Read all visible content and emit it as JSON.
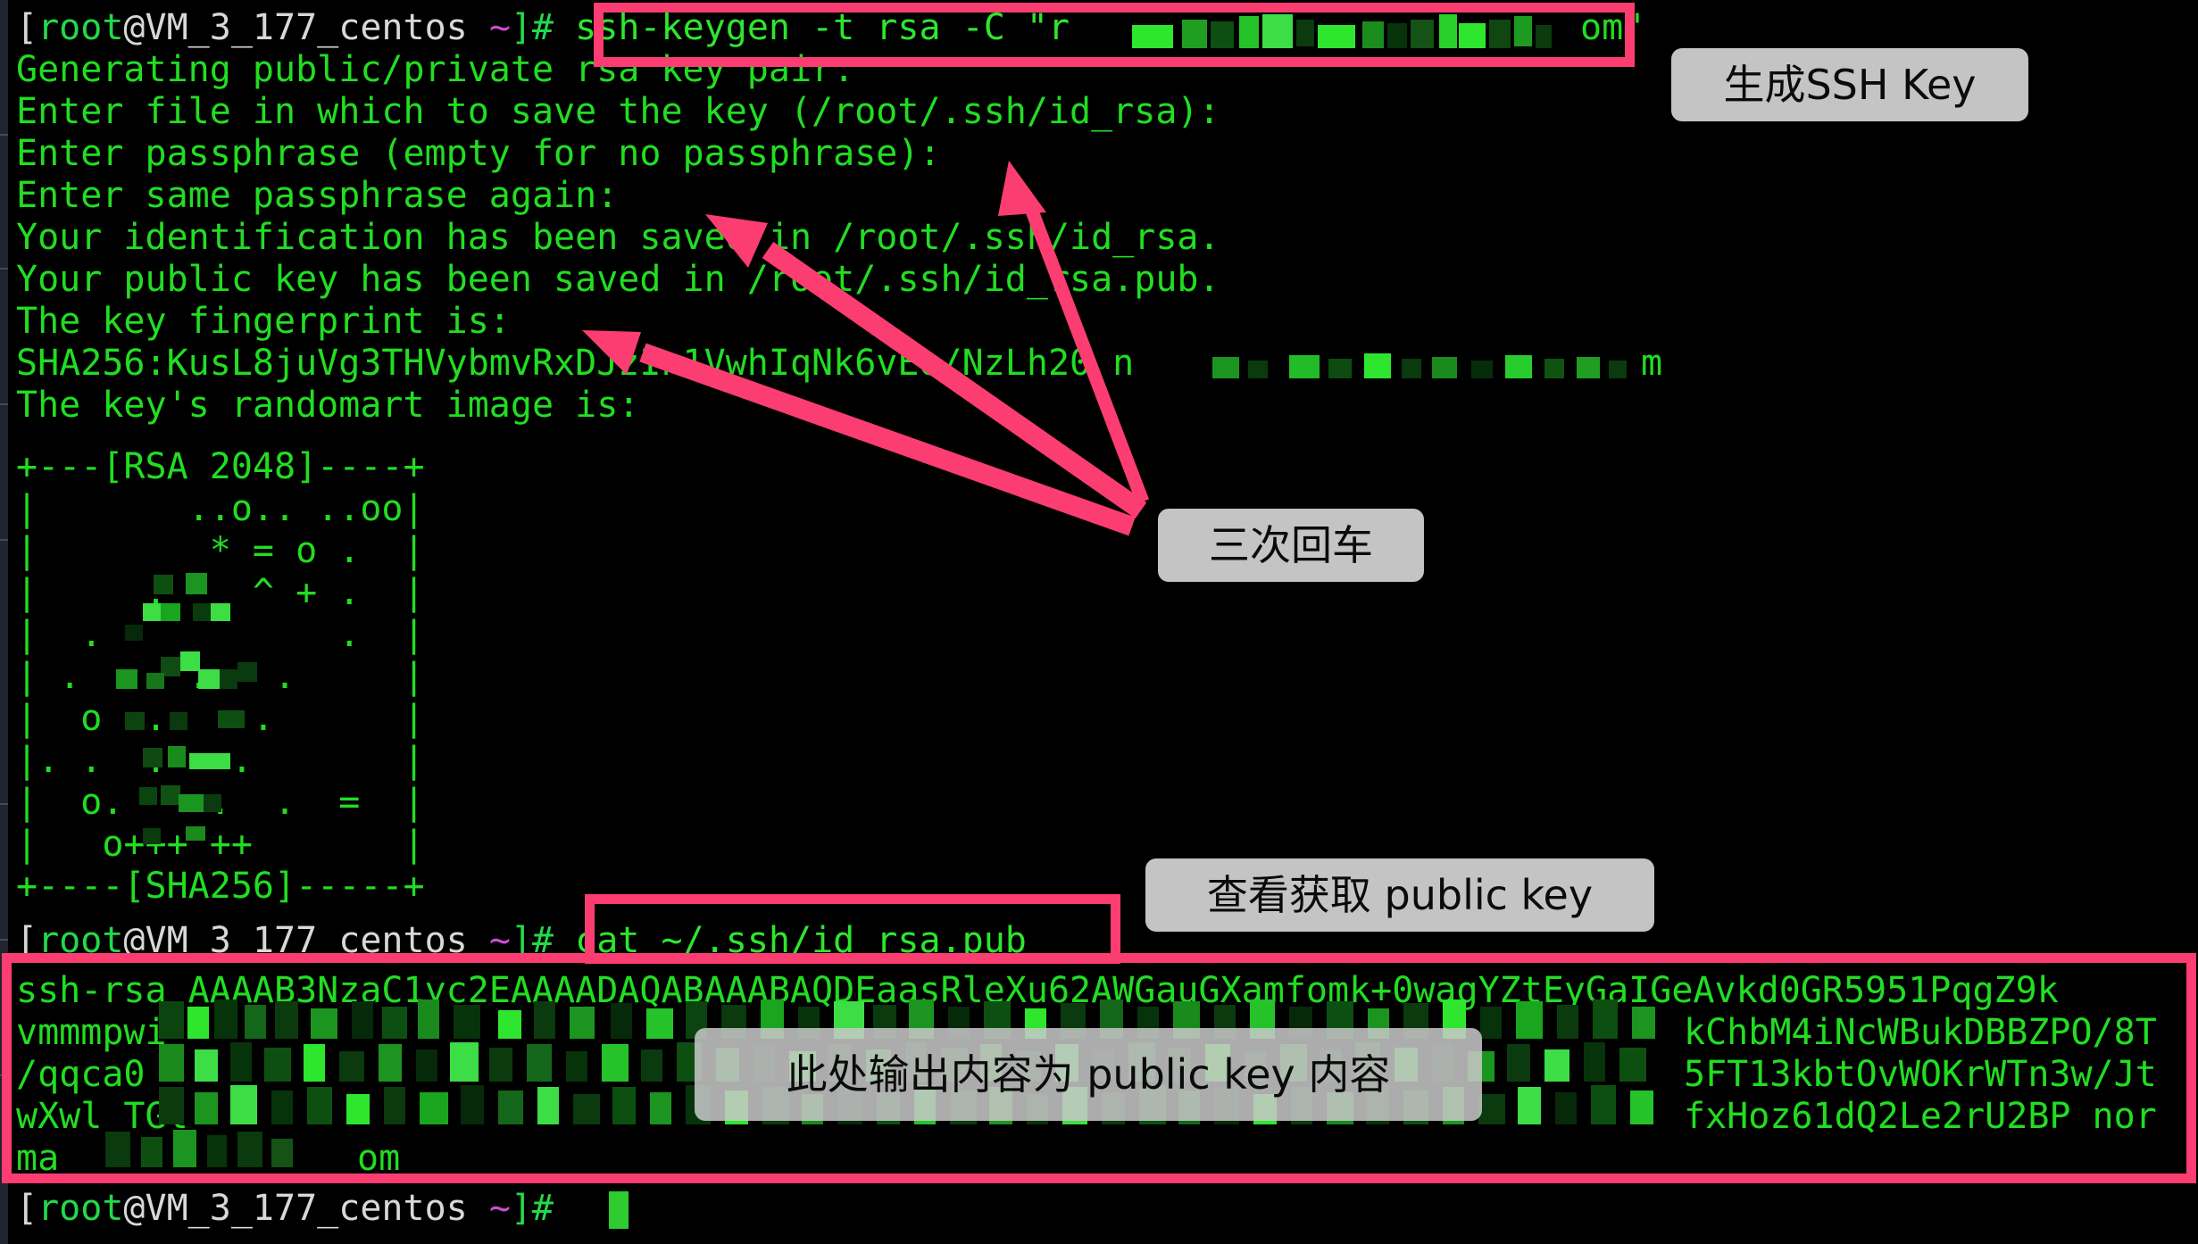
{
  "window": {
    "title": "terminal-ssh-keygen",
    "background": "#000000",
    "accent_pink": "#fb3d71",
    "terminal_green": "#22dd22",
    "callout_gray": "#c4c4c4"
  },
  "terminal": {
    "prompt": {
      "bracket": "[",
      "user": "root",
      "at_host": "@VM_3_177_centos",
      "space_tilde": " ~",
      "close": "]#"
    },
    "lines": [
      {
        "id": "cmd-keygen",
        "prefix_prompt": true,
        "text": " ssh-keygen -t rsa -C \"r",
        "censored_tail": true,
        "suffix": "om\""
      },
      {
        "id": "out-generating",
        "text": "Generating public/private rsa key pair."
      },
      {
        "id": "out-enter-file",
        "text": "Enter file in which to save the key (/root/.ssh/id_rsa):"
      },
      {
        "id": "out-enter-pass",
        "text": "Enter passphrase (empty for no passphrase):"
      },
      {
        "id": "out-enter-pass-again",
        "text": "Enter same passphrase again:"
      },
      {
        "id": "out-identification",
        "text": "Your identification has been saved in /root/.ssh/id_rsa."
      },
      {
        "id": "out-publickey",
        "text": "Your public key has been saved in /root/.ssh/id_rsa.pub."
      },
      {
        "id": "out-fingerprint-label",
        "text": "The key fingerprint is:"
      },
      {
        "id": "out-fingerprint",
        "text": "SHA256:KusL8juVg3THVybmvRxDJzIn1VwhIqNk6vEo/NzLh20 n",
        "censored_tail": true,
        "suffix": "m"
      },
      {
        "id": "out-randomart-label",
        "text": "The key's randomart image is:"
      }
    ],
    "randomart": {
      "header": "+---[RSA 2048]----+",
      "rows": [
        "|       ..o.. ..oo|",
        "|        * = o .  |",
        "|     .    ^ + .  |",
        "|  .           .  |",
        "| .     .   .     |",
        "|  o  .    .      |",
        "|. .  .   .       |",
        "|  o.    .  .  =  |",
        "|   o+++ ++       |"
      ],
      "footer": "+----[SHA256]-----+"
    },
    "cat_command": " cat ~/.ssh/id_rsa.pub",
    "pubkey_lines": [
      {
        "id": "pk-1",
        "visible_head": "ssh-rsa AAAAB3NzaC1yc2EAAAADAQABAAABAQDEaasRleXu62AWGauGXamfomk+0wagYZtEyGaIGeAvkd0GR5951PqgZ9k",
        "visible_tail": ""
      },
      {
        "id": "pk-2",
        "visible_head": "vmmmpwi",
        "visible_tail": "kChbM4iNcWBukDBBZPO/8T"
      },
      {
        "id": "pk-3",
        "visible_head": "/qqca0",
        "visible_tail": "5FT13kbtOvWOKrWTn3w/Jt"
      },
      {
        "id": "pk-4",
        "visible_head": "wXwl TGl",
        "visible_tail": "fxHoz61dQ2Le2rU2BP nor"
      },
      {
        "id": "pk-5",
        "visible_head": "ma",
        "visible_tail": "om"
      }
    ],
    "final_prompt_cursor": "█"
  },
  "annotations": {
    "callouts": [
      {
        "id": "callout-generate-ssh-key",
        "text": "生成SSH Key"
      },
      {
        "id": "callout-three-enters",
        "text": "三次回车"
      },
      {
        "id": "callout-view-public-key",
        "text": "查看获取 public key"
      },
      {
        "id": "callout-output-is-public-key",
        "text": "此处输出内容为 public key 内容"
      }
    ],
    "highlight_boxes": [
      {
        "id": "box-keygen-command"
      },
      {
        "id": "box-cat-command"
      },
      {
        "id": "box-public-key-output"
      }
    ],
    "arrow_count": 3,
    "arrow_color": "#fb3d71"
  }
}
